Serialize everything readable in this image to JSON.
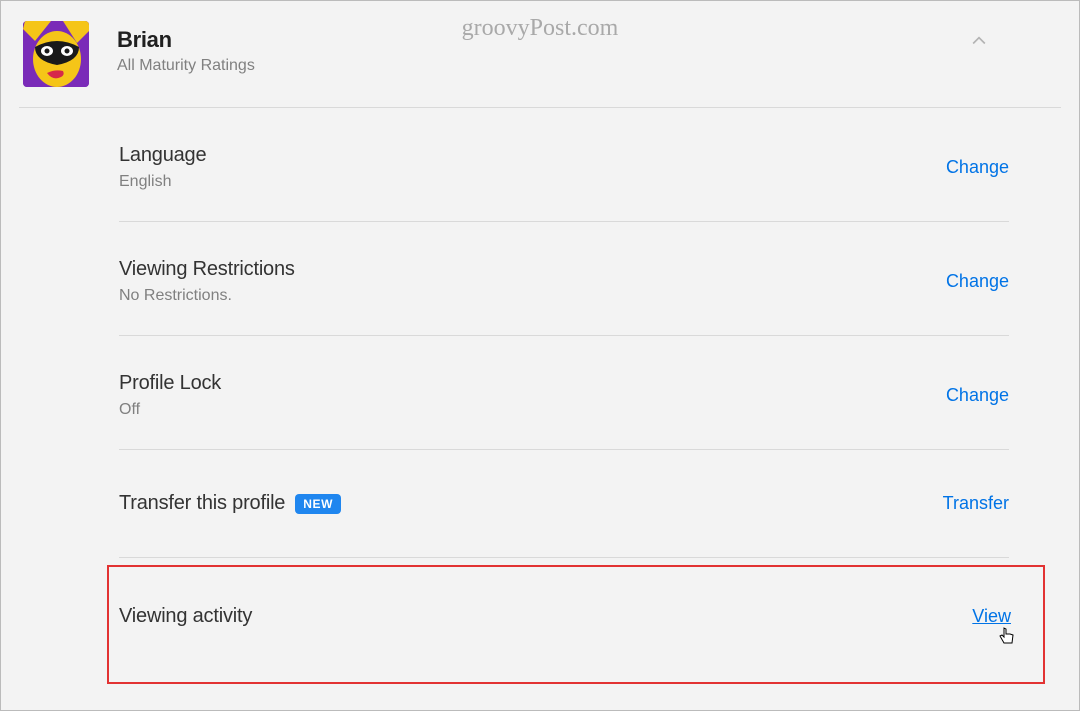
{
  "watermark": "groovyPost.com",
  "profile": {
    "name": "Brian",
    "maturity": "All Maturity Ratings"
  },
  "settings": {
    "language": {
      "title": "Language",
      "value": "English",
      "action": "Change"
    },
    "viewing_restrictions": {
      "title": "Viewing Restrictions",
      "value": "No Restrictions.",
      "action": "Change"
    },
    "profile_lock": {
      "title": "Profile Lock",
      "value": "Off",
      "action": "Change"
    },
    "transfer": {
      "title": "Transfer this profile",
      "badge": "NEW",
      "action": "Transfer"
    },
    "viewing_activity": {
      "title": "Viewing activity",
      "action": "View"
    }
  }
}
